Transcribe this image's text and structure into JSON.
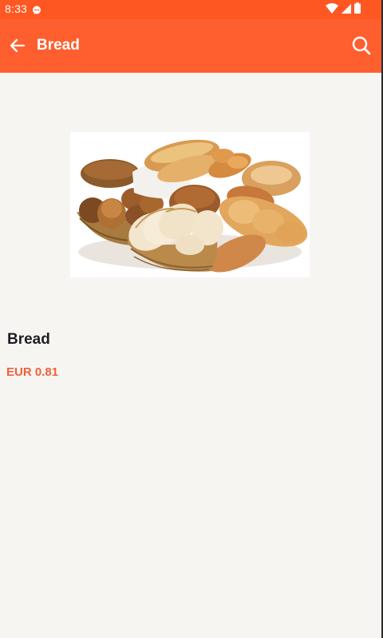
{
  "status_bar": {
    "time": "8:33",
    "icons": [
      "message-icon",
      "wifi-icon",
      "signal-icon",
      "battery-icon"
    ]
  },
  "app_bar": {
    "title": "Bread",
    "back_icon": "arrow-left-icon",
    "search_icon": "search-icon"
  },
  "product": {
    "name": "Bread",
    "price": "EUR 0.81",
    "image": "bread-assortment-photo"
  },
  "colors": {
    "primary": "#ff5e2e",
    "status_bar": "#ff5722",
    "price": "#f0603a",
    "background": "#f7f5f2",
    "title_text": "#1d1f24"
  }
}
